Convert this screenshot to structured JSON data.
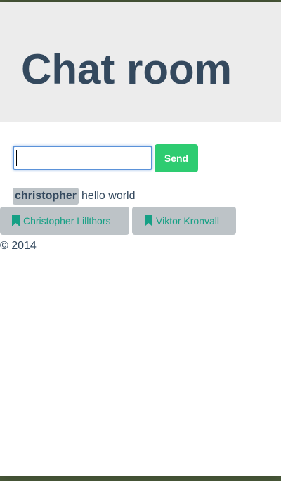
{
  "header": {
    "title": "Chat room"
  },
  "composer": {
    "input_value": "",
    "input_placeholder": "",
    "send_label": "Send"
  },
  "messages": [
    {
      "user": "christopher",
      "text": "hello world"
    }
  ],
  "authors": [
    {
      "name": "Christopher Lillthors",
      "icon": "bookmark-icon"
    },
    {
      "name": "Viktor Kronvall",
      "icon": "bookmark-icon"
    }
  ],
  "footer": {
    "text": "© 2014"
  },
  "colors": {
    "title": "#34495e",
    "send_button": "#2ecc71",
    "author_button_bg": "#bdc3c7",
    "author_button_text": "#16a085",
    "jumbotron_bg": "#ececec"
  }
}
